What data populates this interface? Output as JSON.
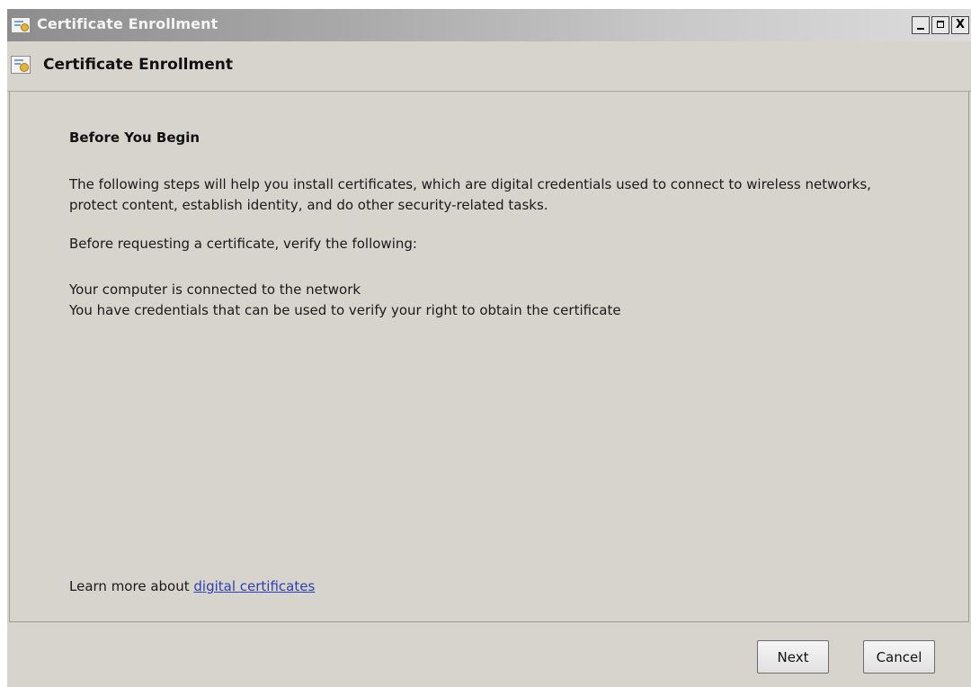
{
  "window": {
    "title": "Certificate Enrollment",
    "controls": {
      "minimize": "_",
      "maximize": "□",
      "close": "X"
    }
  },
  "header": {
    "title": "Certificate Enrollment"
  },
  "content": {
    "section_title": "Before You Begin",
    "intro_line1": "The following steps will help you install certificates, which are digital credentials used to connect to wireless networks,",
    "intro_line2": "protect content, establish identity, and do other security-related tasks.",
    "verify_prompt": "Before requesting a certificate, verify the following:",
    "requirements": [
      "Your computer is connected to the network",
      "You have credentials that can be used to verify your right to obtain the certificate"
    ],
    "learn_more_prefix": "Learn more about ",
    "learn_more_link": "digital certificates"
  },
  "footer": {
    "next_label": "Next",
    "cancel_label": "Cancel"
  },
  "icons": {
    "app": "certificate-icon",
    "link_color": "#2c3fb0"
  }
}
